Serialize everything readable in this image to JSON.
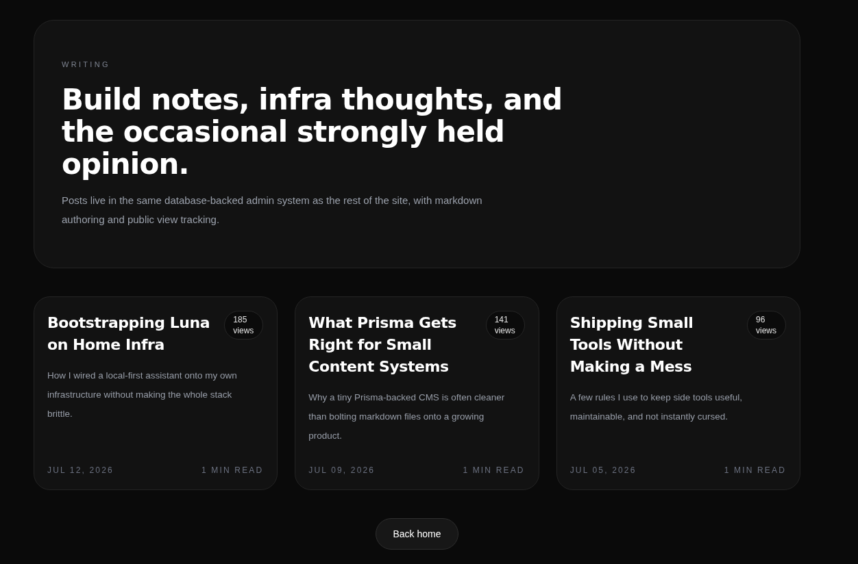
{
  "intro": {
    "eyebrow": "WRITING",
    "title": "Build notes, infra thoughts, and the occasional strongly held opinion.",
    "description": "Posts live in the same database-backed admin system as the rest of the site, with markdown authoring and public view tracking."
  },
  "posts": [
    {
      "title": "Bootstrapping Luna on Home Infra",
      "views": "185 views",
      "excerpt": "How I wired a local-first assistant onto my own infrastructure without making the whole stack brittle.",
      "date": "JUL 12, 2026",
      "read_time": "1 MIN READ"
    },
    {
      "title": "What Prisma Gets Right for Small Content Systems",
      "views": "141 views",
      "excerpt": "Why a tiny Prisma-backed CMS is often cleaner than bolting markdown files onto a growing product.",
      "date": "JUL 09, 2026",
      "read_time": "1 MIN READ"
    },
    {
      "title": "Shipping Small Tools Without Making a Mess",
      "views": "96 views",
      "excerpt": "A few rules I use to keep side tools useful, maintainable, and not instantly cursed.",
      "date": "JUL 05, 2026",
      "read_time": "1 MIN READ"
    }
  ],
  "back_button": "Back home"
}
